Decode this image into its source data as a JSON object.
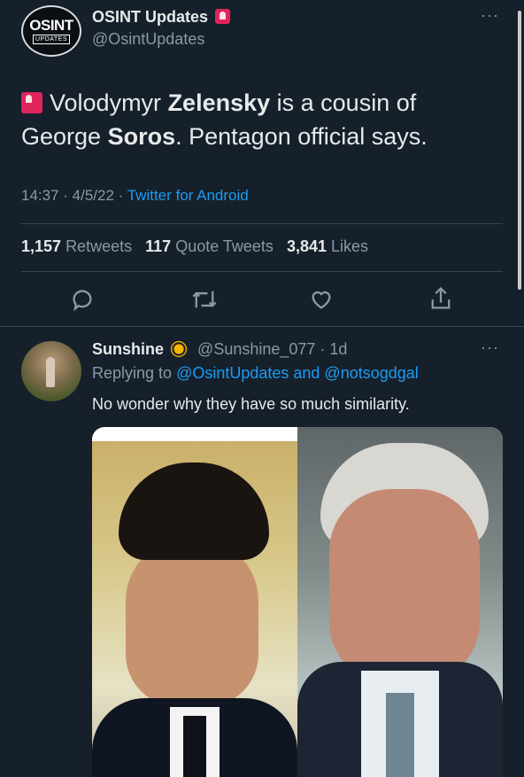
{
  "tweet": {
    "author_name": "OSINT Updates",
    "author_handle": "@OsintUpdates",
    "avatar_text_big": "OSINT",
    "avatar_text_small": "UPDATES",
    "text_parts": [
      "Volodymyr ",
      "Zelensky",
      " is a cousin of",
      "George ",
      "Soros",
      ". Pentagon official says."
    ],
    "time": "14:37 · 4/5/22 · ",
    "client": "Twitter for Android",
    "retweets_count": "1,157",
    "retweets_label": "Retweets",
    "quotes_count": "117",
    "quotes_label": "Quote Tweets",
    "likes_count": "3,841",
    "likes_label": "Likes",
    "more": "···"
  },
  "reply": {
    "author_name": "Sunshine",
    "author_handle": "@Sunshine_077 · 1d",
    "replying_prefix": "Replying to ",
    "replying_to": "@OsintUpdates and @notsogdgal",
    "text": "No wonder why they have so much similarity.",
    "more": "···"
  },
  "icons": {
    "reply": "reply-icon",
    "retweet": "retweet-icon",
    "like": "like-icon",
    "share": "share-icon",
    "siren": "siren-emoji-icon",
    "sun": "sun-emoji-icon"
  },
  "colors": {
    "background": "#15202b",
    "link": "#1d9bf0",
    "muted": "#8b98a5",
    "text": "#e7e9ea"
  }
}
